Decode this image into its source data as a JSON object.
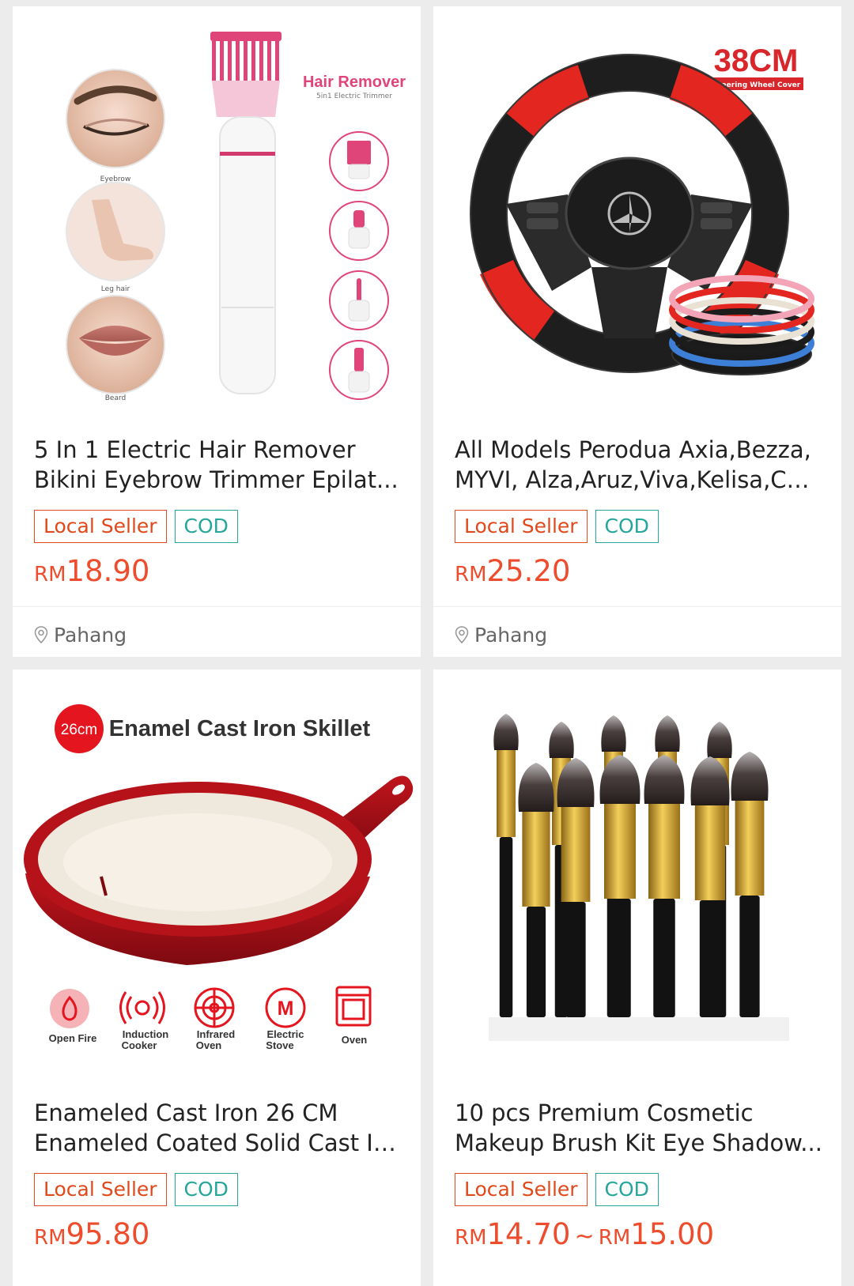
{
  "products": [
    {
      "title_lines": [
        "5 In 1 Electric Hair Remover",
        "Bikini Eyebrow Trimmer Epilat..."
      ],
      "badges": [
        "Local Seller",
        "COD"
      ],
      "price": {
        "currency": "RM",
        "amount": "18.90"
      },
      "location": "Pahang",
      "image_text": {
        "heading": "Hair Remover",
        "subheading": "5in1 Electric Trimmer",
        "captions": [
          "Eyebrow",
          "Leg hair",
          "Beard"
        ]
      }
    },
    {
      "title_lines": [
        "All Models Perodua Axia,Bezza,",
        "MYVI, Alza,Aruz,Viva,Kelisa,Car..."
      ],
      "badges": [
        "Local Seller",
        "COD"
      ],
      "price": {
        "currency": "RM",
        "amount": "25.20"
      },
      "location": "Pahang",
      "image_text": {
        "size_label": "38CM",
        "sub_label": "Steering Wheel Cover"
      }
    },
    {
      "title_lines": [
        "Enameled Cast Iron 26 CM",
        "Enameled Coated Solid Cast Ir..."
      ],
      "badges": [
        "Local Seller",
        "COD"
      ],
      "price": {
        "currency": "RM",
        "amount": "95.80"
      },
      "image_text": {
        "size_label": "26cm",
        "heading": "Enamel Cast Iron Skillet",
        "features": [
          {
            "icon": "fire-icon",
            "lines": [
              "Open Fire",
              ""
            ]
          },
          {
            "icon": "induction-icon",
            "lines": [
              "Induction",
              "Cooker"
            ]
          },
          {
            "icon": "infrared-icon",
            "lines": [
              "Infrared",
              "Oven"
            ]
          },
          {
            "icon": "electric-stove-icon",
            "lines": [
              "Electric",
              "Stove"
            ]
          },
          {
            "icon": "oven-icon",
            "lines": [
              "Oven",
              ""
            ]
          }
        ],
        "stove_letter": "M"
      }
    },
    {
      "title_lines": [
        "10 pcs Premium Cosmetic",
        "Makeup Brush Kit Eye Shadow..."
      ],
      "badges": [
        "Local Seller",
        "COD"
      ],
      "price": {
        "currency": "RM",
        "amount": "14.70",
        "separator": "~",
        "currency_max": "RM",
        "amount_max": "15.00"
      }
    }
  ]
}
